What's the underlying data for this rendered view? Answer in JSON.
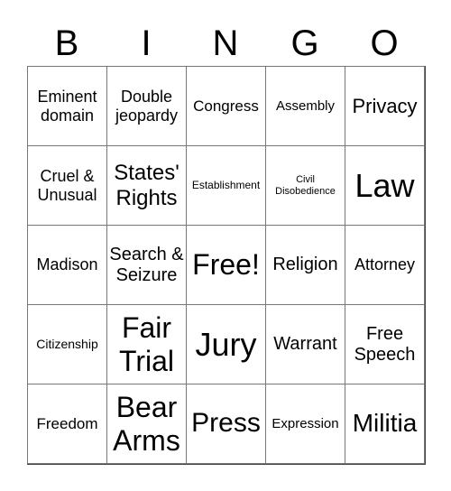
{
  "header": [
    "B",
    "I",
    "N",
    "G",
    "O"
  ],
  "cells": [
    "Eminent domain",
    "Double jeopardy",
    "Congress",
    "Assembly",
    "Privacy",
    "Cruel & Unusual",
    "States' Rights",
    "Establishment",
    "Civil Disobedience",
    "Law",
    "Madison",
    "Search & Seizure",
    "Free!",
    "Religion",
    "Attorney",
    "Citizenship",
    "Fair Trial",
    "Jury",
    "Warrant",
    "Free Speech",
    "Freedom",
    "Bear Arms",
    "Press",
    "Expression",
    "Militia"
  ]
}
